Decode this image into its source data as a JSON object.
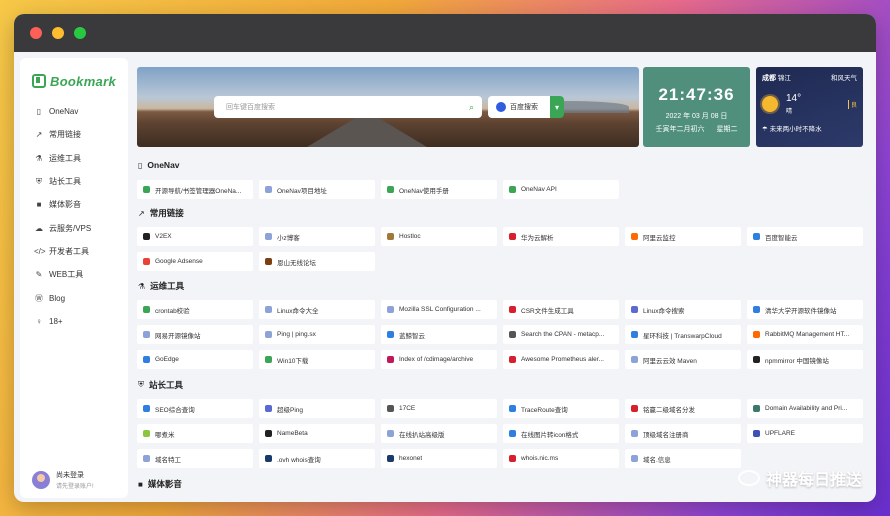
{
  "app": {
    "logo_text": "Bookmark"
  },
  "sidebar": {
    "items": [
      {
        "icon": "bookmark-icon",
        "glyph": "▯",
        "label": "OneNav"
      },
      {
        "icon": "external-link-icon",
        "glyph": "↗",
        "label": "常用链接"
      },
      {
        "icon": "flask-icon",
        "glyph": "⚗",
        "label": "运维工具"
      },
      {
        "icon": "shield-icon",
        "glyph": "⛨",
        "label": "站长工具"
      },
      {
        "icon": "video-icon",
        "glyph": "■",
        "label": "媒体影音"
      },
      {
        "icon": "cloud-icon",
        "glyph": "☁",
        "label": "云服务/VPS"
      },
      {
        "icon": "code-icon",
        "glyph": "</>",
        "label": "开发者工具"
      },
      {
        "icon": "wrench-icon",
        "glyph": "✎",
        "label": "WEB工具"
      },
      {
        "icon": "wordpress-icon",
        "glyph": "Ⓦ",
        "label": "Blog"
      },
      {
        "icon": "person-icon",
        "glyph": "♀",
        "label": "18+"
      }
    ],
    "user": {
      "name": "尚未登录",
      "sub": "请先登录账户!"
    }
  },
  "search": {
    "placeholder": "回车键百度搜索",
    "engine_label": "百度搜索"
  },
  "clock": {
    "time": "21:47:36",
    "date": "2022 年 03 月 08 日",
    "lunar": "壬寅年二月初六",
    "weekday": "星期二"
  },
  "weather": {
    "city": "成都",
    "district": "锦江",
    "wind": "和风天气",
    "temp": "14°",
    "desc": "晴",
    "air": "良",
    "forecast": "未来两小时不降水"
  },
  "sections": [
    {
      "title": "OneNav",
      "icon": "bookmark-icon",
      "glyph": "▯",
      "cards": [
        {
          "label": "开源导航/书签管理器OneNa...",
          "color": "#3aa655"
        },
        {
          "label": "OneNav项目地址",
          "color": "#8da2d8"
        },
        {
          "label": "OneNav使用手册",
          "color": "#3aa655"
        },
        {
          "label": "OneNav API",
          "color": "#3aa655"
        }
      ]
    },
    {
      "title": "常用链接",
      "icon": "external-link-icon",
      "glyph": "↗",
      "cards": [
        {
          "label": "V2EX",
          "color": "#222222"
        },
        {
          "label": "小z博客",
          "color": "#8da2d8"
        },
        {
          "label": "Hostloc",
          "color": "#a0783a"
        },
        {
          "label": "华为云解析",
          "color": "#d7202d"
        },
        {
          "label": "阿里云监控",
          "color": "#ff6a00"
        },
        {
          "label": "百度智能云",
          "color": "#2f7fe0"
        },
        {
          "label": "Google Adsense",
          "color": "#ea4335"
        },
        {
          "label": "恩山无线论坛",
          "color": "#7b3f12"
        }
      ]
    },
    {
      "title": "运维工具",
      "icon": "flask-icon",
      "glyph": "⚗",
      "cards": [
        {
          "label": "crontab校验",
          "color": "#3aa655"
        },
        {
          "label": "Linux命令大全",
          "color": "#8da2d8"
        },
        {
          "label": "Mozilla SSL Configuration ...",
          "color": "#8da2d8"
        },
        {
          "label": "CSR文件生成工具",
          "color": "#d7202d"
        },
        {
          "label": "Linux命令搜索",
          "color": "#5a6ad0"
        },
        {
          "label": "清华大学开源软件镜像站",
          "color": "#2f7fe0"
        },
        {
          "label": "网易开源镜像站",
          "color": "#8da2d8"
        },
        {
          "label": "Ping | ping.sx",
          "color": "#8da2d8"
        },
        {
          "label": "蓝鲸智云",
          "color": "#2f7fe0"
        },
        {
          "label": "Search the CPAN - metacp...",
          "color": "#555555"
        },
        {
          "label": "星环科技 | TranswarpCloud",
          "color": "#2f7fe0"
        },
        {
          "label": "RabbitMQ Management HT...",
          "color": "#ff6a00"
        },
        {
          "label": "GoEdge",
          "color": "#2f7fe0"
        },
        {
          "label": "Win10下载",
          "color": "#3aa655"
        },
        {
          "label": "Index of /cdimage/archive",
          "color": "#c2185b"
        },
        {
          "label": "Awesome Prometheus aler...",
          "color": "#d7202d"
        },
        {
          "label": "阿里云云效 Maven",
          "color": "#8da2d8"
        },
        {
          "label": "npmmirror 中国镜像站",
          "color": "#222222"
        }
      ]
    },
    {
      "title": "站长工具",
      "icon": "shield-icon",
      "glyph": "⛨",
      "cards": [
        {
          "label": "SEO综合查询",
          "color": "#2f7fe0"
        },
        {
          "label": "超级Ping",
          "color": "#5a6ad0"
        },
        {
          "label": "17CE",
          "color": "#555555"
        },
        {
          "label": "TraceRoute查询",
          "color": "#2f7fe0"
        },
        {
          "label": "铭赢二级域名分发",
          "color": "#d7202d"
        },
        {
          "label": "Domain Availability and Pri...",
          "color": "#3a7a6a"
        },
        {
          "label": "哪煮米",
          "color": "#8cc63f"
        },
        {
          "label": "NameBeta",
          "color": "#222222"
        },
        {
          "label": "在线扒站高级版",
          "color": "#8da2d8"
        },
        {
          "label": "在线图片转icon格式",
          "color": "#2f7fe0"
        },
        {
          "label": "顶级域名注册商",
          "color": "#8da2d8"
        },
        {
          "label": "UPFLARE",
          "color": "#3f51b5"
        },
        {
          "label": "域名特工",
          "color": "#8da2d8"
        },
        {
          "label": ".ovh whois查询",
          "color": "#1a3a6a"
        },
        {
          "label": "hexonet",
          "color": "#1a3a6a"
        },
        {
          "label": "whois.nic.ms",
          "color": "#d7202d"
        },
        {
          "label": "域名.信息",
          "color": "#8da2d8"
        }
      ]
    },
    {
      "title": "媒体影音",
      "icon": "video-icon",
      "glyph": "■",
      "cards": []
    }
  ],
  "watermark": {
    "text": "神器每日推送"
  }
}
